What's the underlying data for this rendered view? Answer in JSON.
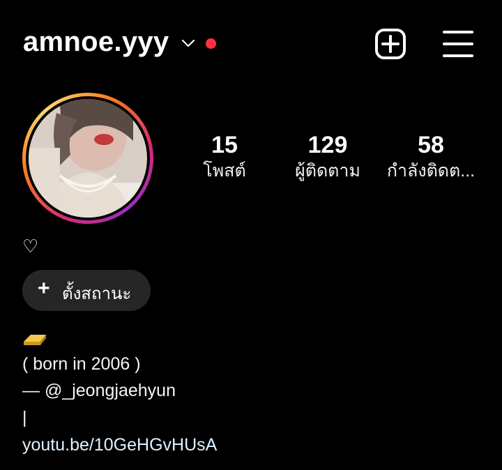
{
  "header": {
    "username": "amnoe.yyy",
    "icons": [
      "chevron-down-icon",
      "notification-dot",
      "add-post-icon",
      "menu-icon"
    ],
    "accent_dot_color": "#ff3040"
  },
  "stats": [
    {
      "count": "15",
      "label": "โพสต์"
    },
    {
      "count": "129",
      "label": "ผู้ติดตาม"
    },
    {
      "count": "58",
      "label": "กำลังติดต..."
    }
  ],
  "profile": {
    "heart": "♡",
    "status_button": {
      "plus": "+",
      "label": "ตั้งสถานะ"
    }
  },
  "bio": {
    "line1": "( born in 2006 )",
    "line2": "— @_jeongjaehyun",
    "line3": "|",
    "link": "youtu.be/10GeHGvHUsA"
  }
}
